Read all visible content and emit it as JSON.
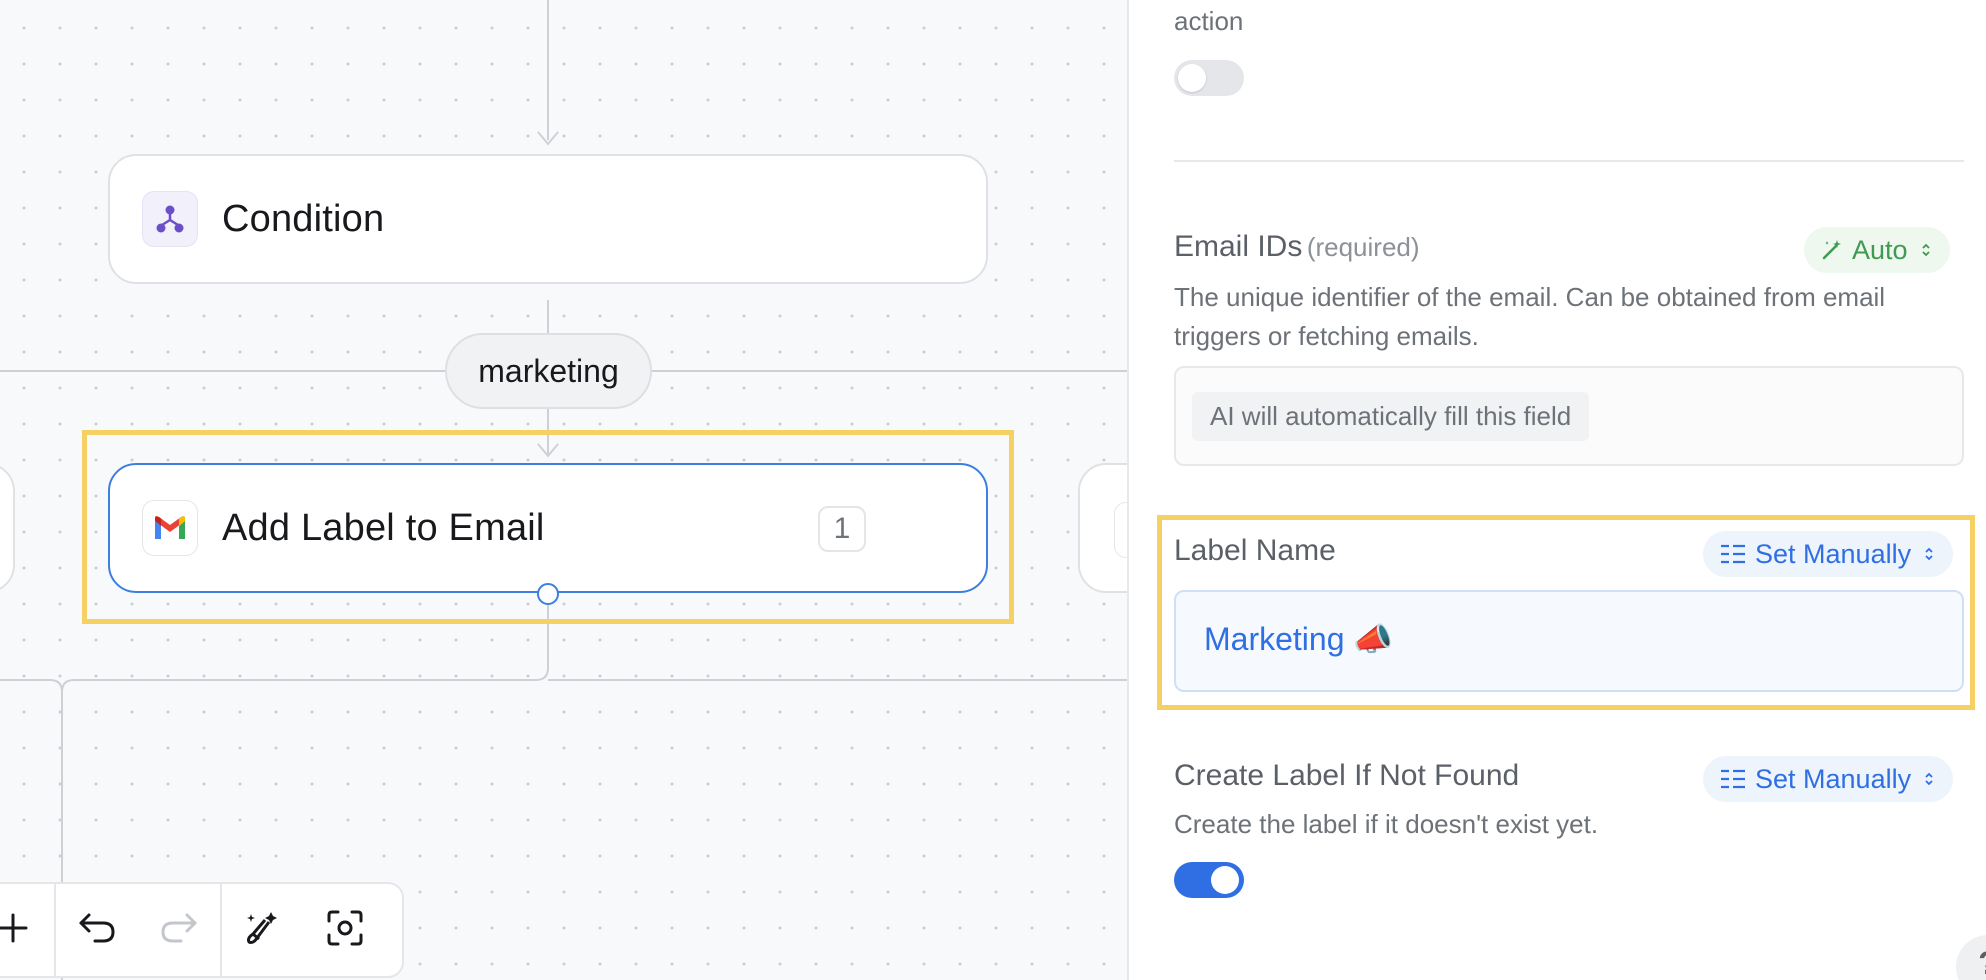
{
  "canvas": {
    "nodes": {
      "condition": {
        "title": "Condition",
        "icon": "branch-icon"
      },
      "add_label": {
        "title": "Add Label to Email",
        "icon": "gmail-icon",
        "count": "1"
      }
    },
    "branch_label": "marketing",
    "toolbar": {
      "items": [
        "plus-icon",
        "undo-icon",
        "redo-icon",
        "magic-clean-icon",
        "focus-icon"
      ]
    }
  },
  "panel": {
    "top_label": "action",
    "email_ids": {
      "label": "Email IDs",
      "required": "(required)",
      "mode": "Auto",
      "description": "The unique identifier of the email. Can be obtained from email triggers or fetching emails.",
      "placeholder_chip": "AI will automatically fill this field"
    },
    "label_name": {
      "label": "Label Name",
      "mode": "Set Manually",
      "value": "Marketing 📣"
    },
    "create_label": {
      "label": "Create Label If Not Found",
      "mode": "Set Manually",
      "description": "Create the label if it doesn't exist yet."
    },
    "help": "?"
  },
  "colors": {
    "accent_blue": "#2f6fe3",
    "node_selected_border": "#3b7fe0",
    "highlight_yellow": "#f5d163",
    "auto_green": "#3f9a52"
  }
}
